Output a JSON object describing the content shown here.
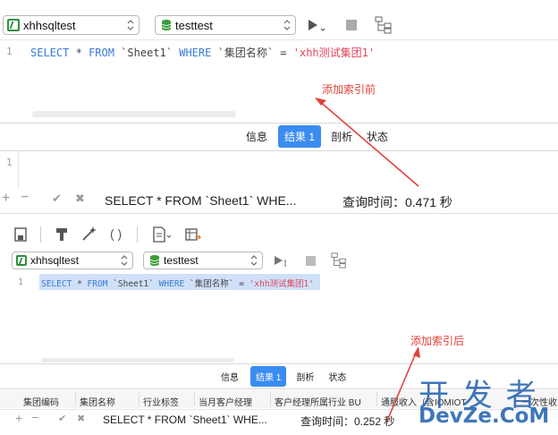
{
  "top": {
    "connection": "xhhsqltest",
    "database": "testtest",
    "line_number": "1",
    "sql": {
      "kw_select": "SELECT",
      "star": "*",
      "kw_from": "FROM",
      "table": "`Sheet1`",
      "kw_where": "WHERE",
      "column": "`集团名称`",
      "eq": "=",
      "value": "'xhh测试集团1'"
    },
    "tabs": [
      "信息",
      "结果 1",
      "剖析",
      "状态"
    ],
    "result_line_number": "1",
    "footer_query": "SELECT * FROM `Sheet1` WHE...",
    "footer_time": "查询时间：0.471 秒",
    "annotation": "添加索引前"
  },
  "bottom": {
    "connection": "xhhsqltest",
    "database": "testtest",
    "line_number": "1",
    "sql": {
      "kw_select": "SELECT",
      "star": "*",
      "kw_from": "FROM",
      "table": "`Sheet1`",
      "kw_where": "WHERE",
      "column": "`集团名称`",
      "eq": "=",
      "value": "'xhh测试集团1'"
    },
    "tabs": [
      "信息",
      "结果 1",
      "剖析",
      "状态"
    ],
    "columns": [
      "集团编码",
      "集团名称",
      "行业标签",
      "当月客户经理",
      "客户经理所属行业 BU",
      "通服收入（含IOMIOT",
      "一次性收入（标准"
    ],
    "footer_query": "SELECT * FROM `Sheet1` WHE...",
    "footer_time": "查询时间：0.252 秒",
    "annotation": "添加索引后"
  },
  "watermark": {
    "line1": "开 发 者",
    "line2": "DevZe.CoM"
  },
  "colors": {
    "accent": "#3b8cf1",
    "keyword": "#3a7bd5",
    "string": "#e0445a",
    "annotation": "#e0443a"
  }
}
